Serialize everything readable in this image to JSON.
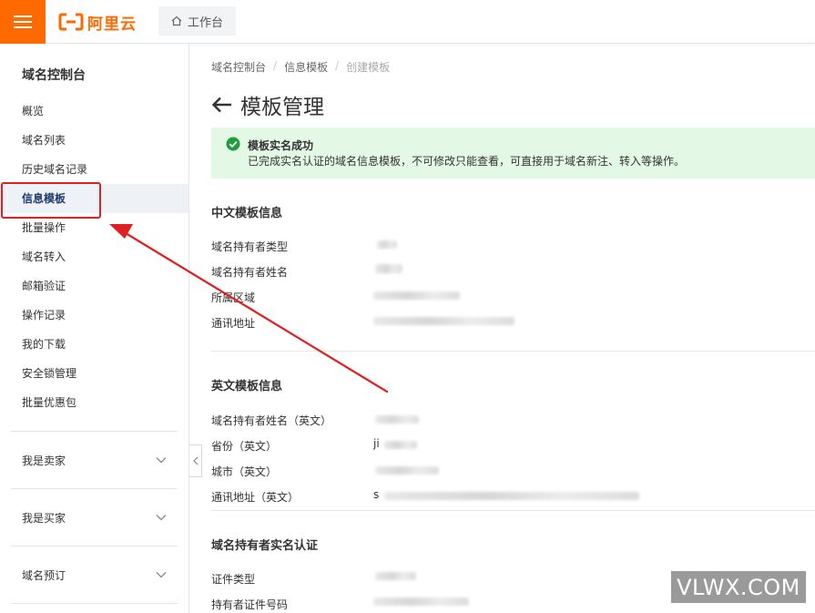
{
  "topbar": {
    "brand": "阿里云",
    "workbench_label": "工作台",
    "brand_color": "#ff6a00"
  },
  "sidebar": {
    "title": "域名控制台",
    "items": [
      {
        "label": "概览"
      },
      {
        "label": "域名列表"
      },
      {
        "label": "历史域名记录"
      },
      {
        "label": "信息模板",
        "active": true
      },
      {
        "label": "批量操作"
      },
      {
        "label": "域名转入"
      },
      {
        "label": "邮箱验证"
      },
      {
        "label": "操作记录"
      },
      {
        "label": "我的下载"
      },
      {
        "label": "安全锁管理"
      },
      {
        "label": "批量优惠包"
      }
    ],
    "groups": [
      {
        "label": "我是卖家"
      },
      {
        "label": "我是买家"
      },
      {
        "label": "域名预订"
      }
    ]
  },
  "breadcrumb": [
    "域名控制台",
    "信息模板",
    "创建模板"
  ],
  "page": {
    "title": "模板管理"
  },
  "alert": {
    "title": "模板实名成功",
    "description": "已完成实名认证的域名信息模板，不可修改只能查看，可直接用于域名新注、转入等操作。",
    "color": "#e4f8e6",
    "icon": "check-circle-icon"
  },
  "sections": {
    "chinese": {
      "title": "中文模板信息",
      "fields": [
        {
          "label": "域名持有者类型"
        },
        {
          "label": "域名持有者姓名"
        },
        {
          "label": "所属区域"
        },
        {
          "label": "通讯地址"
        }
      ]
    },
    "english": {
      "title": "英文模板信息",
      "fields": [
        {
          "label": "域名持有者姓名（英文）"
        },
        {
          "label": "省份（英文）",
          "partial_value": "ji"
        },
        {
          "label": "城市（英文）"
        },
        {
          "label": "通讯地址（英文）",
          "partial_value": "s"
        }
      ]
    },
    "verification": {
      "title": "域名持有者实名认证",
      "fields": [
        {
          "label": "证件类型"
        },
        {
          "label": "持有者证件号码"
        }
      ]
    }
  },
  "watermark": "VLWX.COM"
}
